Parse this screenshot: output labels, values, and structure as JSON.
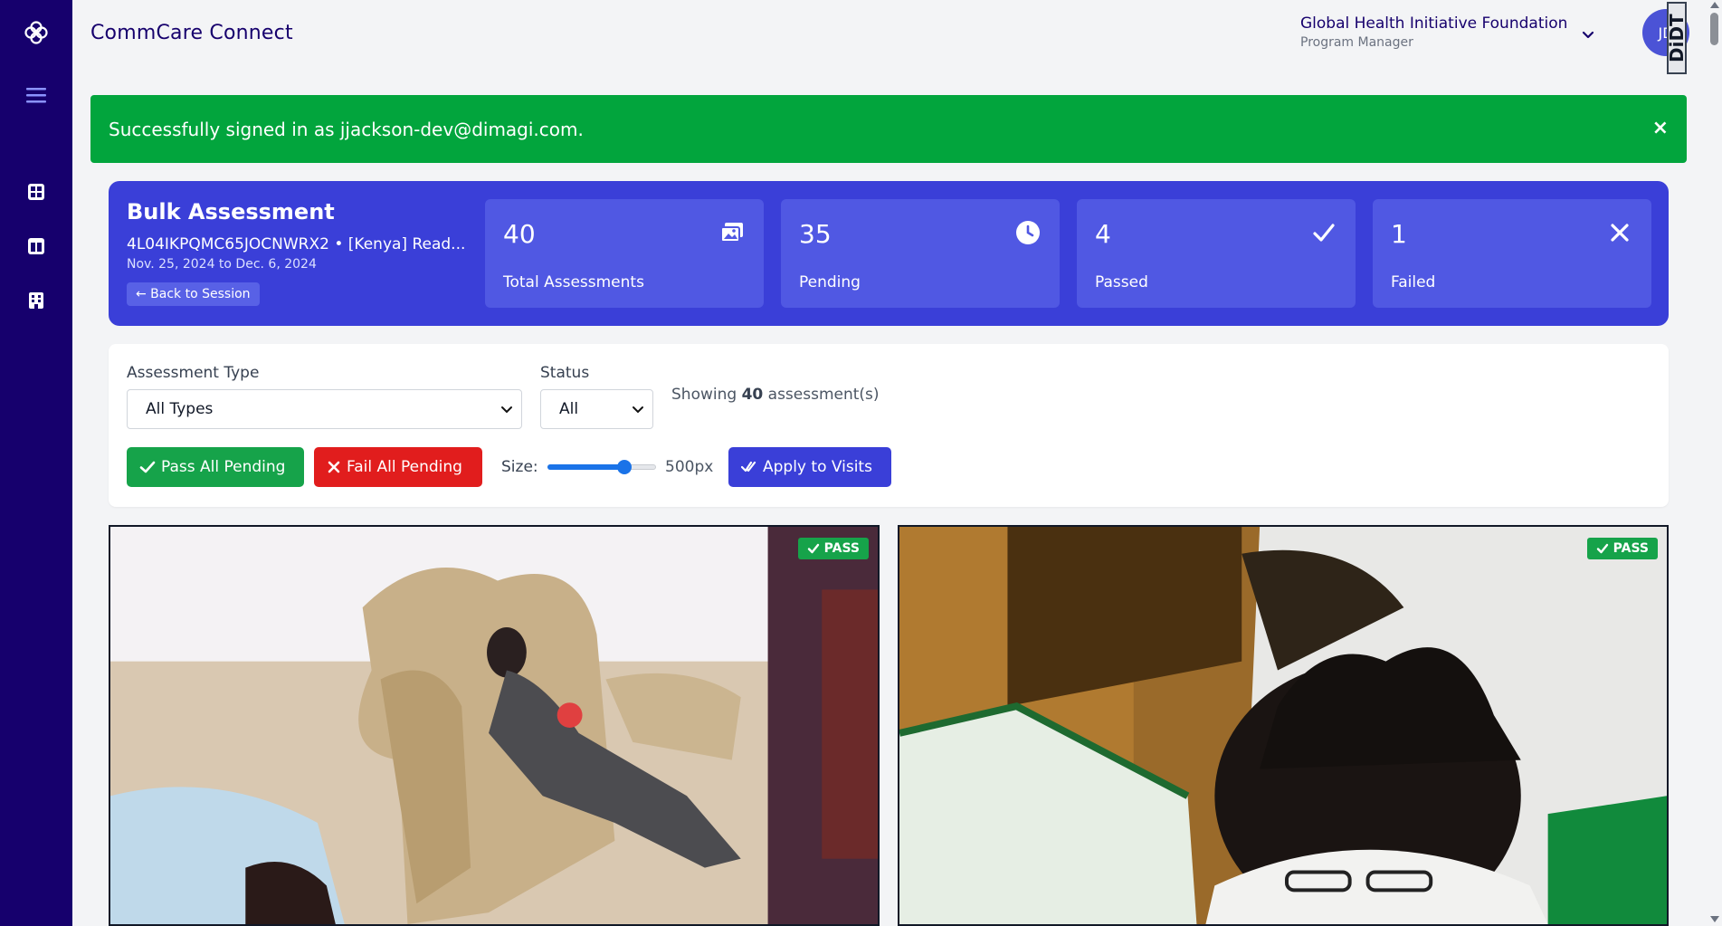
{
  "app": {
    "title": "CommCare Connect"
  },
  "org": {
    "name": "Global Health Initiative Foundation",
    "role": "Program Manager"
  },
  "user": {
    "initials": "JD"
  },
  "extension_badge": "DiDT",
  "alert": {
    "message": "Successfully signed in as jjackson-dev@dimagi.com.",
    "close": "×"
  },
  "summary": {
    "title": "Bulk Assessment",
    "subtitle": "4L04IKPQMC65JOCNWRX2 • [Kenya] Read...",
    "date_range": "Nov. 25, 2024 to Dec. 6, 2024",
    "back_label": "← Back to Session",
    "stats": [
      {
        "value": "40",
        "label": "Total Assessments",
        "icon": "images-icon"
      },
      {
        "value": "35",
        "label": "Pending",
        "icon": "clock-icon"
      },
      {
        "value": "4",
        "label": "Passed",
        "icon": "check-icon"
      },
      {
        "value": "1",
        "label": "Failed",
        "icon": "x-icon"
      }
    ]
  },
  "filters": {
    "type_label": "Assessment Type",
    "type_value": "All Types",
    "status_label": "Status",
    "status_value": "All",
    "showing_prefix": "Showing",
    "showing_count": "40",
    "showing_suffix": "assessment(s)",
    "pass_all_label": "Pass All Pending",
    "fail_all_label": "Fail All Pending",
    "size_label": "Size:",
    "size_value": "500px",
    "size_fraction": 0.71,
    "apply_label": "Apply to Visits"
  },
  "cards": [
    {
      "status": "PASS"
    },
    {
      "status": "PASS"
    }
  ],
  "colors": {
    "sidebar": "#16006d",
    "primary": "#3a3fd8",
    "success": "#16a34a",
    "danger": "#e11d1d",
    "alert": "#02a53d"
  }
}
